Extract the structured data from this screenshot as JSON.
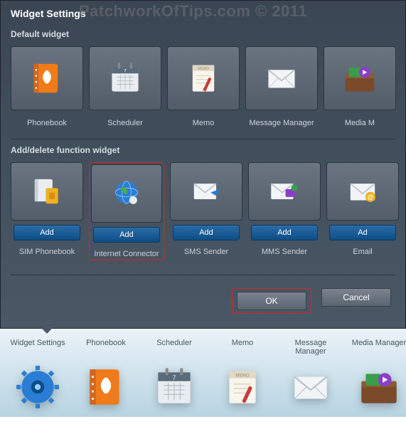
{
  "dialog": {
    "title": "Widget Settings",
    "section_default": "Default widget",
    "section_func": "Add/delete function widget",
    "ok": "OK",
    "cancel": "Cancel"
  },
  "watermark": "PatchworkOfTips.com © 2011",
  "default_widgets": [
    {
      "label": "Phonebook",
      "icon": "phonebook"
    },
    {
      "label": "Scheduler",
      "icon": "calendar"
    },
    {
      "label": "Memo",
      "icon": "memo"
    },
    {
      "label": "Message Manager",
      "icon": "envelope"
    },
    {
      "label": "Media M",
      "icon": "media"
    }
  ],
  "func_widgets": [
    {
      "label": "SIM Phonebook",
      "icon": "sim-phonebook",
      "add": "Add",
      "highlight": false
    },
    {
      "label": "Internet Connector",
      "icon": "globe",
      "add": "Add",
      "highlight": true
    },
    {
      "label": "SMS Sender",
      "icon": "sms",
      "add": "Add",
      "highlight": false
    },
    {
      "label": "MMS Sender",
      "icon": "mms",
      "add": "Add",
      "highlight": false
    },
    {
      "label": "Email",
      "icon": "email",
      "add": "Ad",
      "highlight": false
    }
  ],
  "dock": [
    {
      "label": "Widget Settings",
      "icon": "gear"
    },
    {
      "label": "Phonebook",
      "icon": "phonebook"
    },
    {
      "label": "Scheduler",
      "icon": "calendar"
    },
    {
      "label": "Memo",
      "icon": "memo"
    },
    {
      "label": "Message Manager",
      "icon": "envelope"
    },
    {
      "label": "Media Manager",
      "icon": "media"
    }
  ]
}
